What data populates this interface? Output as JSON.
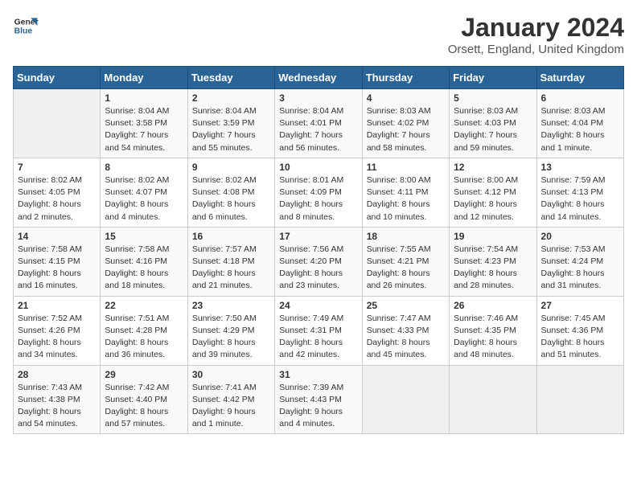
{
  "logo": {
    "line1": "General",
    "line2": "Blue"
  },
  "title": "January 2024",
  "subtitle": "Orsett, England, United Kingdom",
  "weekdays": [
    "Sunday",
    "Monday",
    "Tuesday",
    "Wednesday",
    "Thursday",
    "Friday",
    "Saturday"
  ],
  "weeks": [
    [
      {
        "day": "",
        "info": ""
      },
      {
        "day": "1",
        "info": "Sunrise: 8:04 AM\nSunset: 3:58 PM\nDaylight: 7 hours\nand 54 minutes."
      },
      {
        "day": "2",
        "info": "Sunrise: 8:04 AM\nSunset: 3:59 PM\nDaylight: 7 hours\nand 55 minutes."
      },
      {
        "day": "3",
        "info": "Sunrise: 8:04 AM\nSunset: 4:01 PM\nDaylight: 7 hours\nand 56 minutes."
      },
      {
        "day": "4",
        "info": "Sunrise: 8:03 AM\nSunset: 4:02 PM\nDaylight: 7 hours\nand 58 minutes."
      },
      {
        "day": "5",
        "info": "Sunrise: 8:03 AM\nSunset: 4:03 PM\nDaylight: 7 hours\nand 59 minutes."
      },
      {
        "day": "6",
        "info": "Sunrise: 8:03 AM\nSunset: 4:04 PM\nDaylight: 8 hours\nand 1 minute."
      }
    ],
    [
      {
        "day": "7",
        "info": "Sunrise: 8:02 AM\nSunset: 4:05 PM\nDaylight: 8 hours\nand 2 minutes."
      },
      {
        "day": "8",
        "info": "Sunrise: 8:02 AM\nSunset: 4:07 PM\nDaylight: 8 hours\nand 4 minutes."
      },
      {
        "day": "9",
        "info": "Sunrise: 8:02 AM\nSunset: 4:08 PM\nDaylight: 8 hours\nand 6 minutes."
      },
      {
        "day": "10",
        "info": "Sunrise: 8:01 AM\nSunset: 4:09 PM\nDaylight: 8 hours\nand 8 minutes."
      },
      {
        "day": "11",
        "info": "Sunrise: 8:00 AM\nSunset: 4:11 PM\nDaylight: 8 hours\nand 10 minutes."
      },
      {
        "day": "12",
        "info": "Sunrise: 8:00 AM\nSunset: 4:12 PM\nDaylight: 8 hours\nand 12 minutes."
      },
      {
        "day": "13",
        "info": "Sunrise: 7:59 AM\nSunset: 4:13 PM\nDaylight: 8 hours\nand 14 minutes."
      }
    ],
    [
      {
        "day": "14",
        "info": "Sunrise: 7:58 AM\nSunset: 4:15 PM\nDaylight: 8 hours\nand 16 minutes."
      },
      {
        "day": "15",
        "info": "Sunrise: 7:58 AM\nSunset: 4:16 PM\nDaylight: 8 hours\nand 18 minutes."
      },
      {
        "day": "16",
        "info": "Sunrise: 7:57 AM\nSunset: 4:18 PM\nDaylight: 8 hours\nand 21 minutes."
      },
      {
        "day": "17",
        "info": "Sunrise: 7:56 AM\nSunset: 4:20 PM\nDaylight: 8 hours\nand 23 minutes."
      },
      {
        "day": "18",
        "info": "Sunrise: 7:55 AM\nSunset: 4:21 PM\nDaylight: 8 hours\nand 26 minutes."
      },
      {
        "day": "19",
        "info": "Sunrise: 7:54 AM\nSunset: 4:23 PM\nDaylight: 8 hours\nand 28 minutes."
      },
      {
        "day": "20",
        "info": "Sunrise: 7:53 AM\nSunset: 4:24 PM\nDaylight: 8 hours\nand 31 minutes."
      }
    ],
    [
      {
        "day": "21",
        "info": "Sunrise: 7:52 AM\nSunset: 4:26 PM\nDaylight: 8 hours\nand 34 minutes."
      },
      {
        "day": "22",
        "info": "Sunrise: 7:51 AM\nSunset: 4:28 PM\nDaylight: 8 hours\nand 36 minutes."
      },
      {
        "day": "23",
        "info": "Sunrise: 7:50 AM\nSunset: 4:29 PM\nDaylight: 8 hours\nand 39 minutes."
      },
      {
        "day": "24",
        "info": "Sunrise: 7:49 AM\nSunset: 4:31 PM\nDaylight: 8 hours\nand 42 minutes."
      },
      {
        "day": "25",
        "info": "Sunrise: 7:47 AM\nSunset: 4:33 PM\nDaylight: 8 hours\nand 45 minutes."
      },
      {
        "day": "26",
        "info": "Sunrise: 7:46 AM\nSunset: 4:35 PM\nDaylight: 8 hours\nand 48 minutes."
      },
      {
        "day": "27",
        "info": "Sunrise: 7:45 AM\nSunset: 4:36 PM\nDaylight: 8 hours\nand 51 minutes."
      }
    ],
    [
      {
        "day": "28",
        "info": "Sunrise: 7:43 AM\nSunset: 4:38 PM\nDaylight: 8 hours\nand 54 minutes."
      },
      {
        "day": "29",
        "info": "Sunrise: 7:42 AM\nSunset: 4:40 PM\nDaylight: 8 hours\nand 57 minutes."
      },
      {
        "day": "30",
        "info": "Sunrise: 7:41 AM\nSunset: 4:42 PM\nDaylight: 9 hours\nand 1 minute."
      },
      {
        "day": "31",
        "info": "Sunrise: 7:39 AM\nSunset: 4:43 PM\nDaylight: 9 hours\nand 4 minutes."
      },
      {
        "day": "",
        "info": ""
      },
      {
        "day": "",
        "info": ""
      },
      {
        "day": "",
        "info": ""
      }
    ]
  ]
}
